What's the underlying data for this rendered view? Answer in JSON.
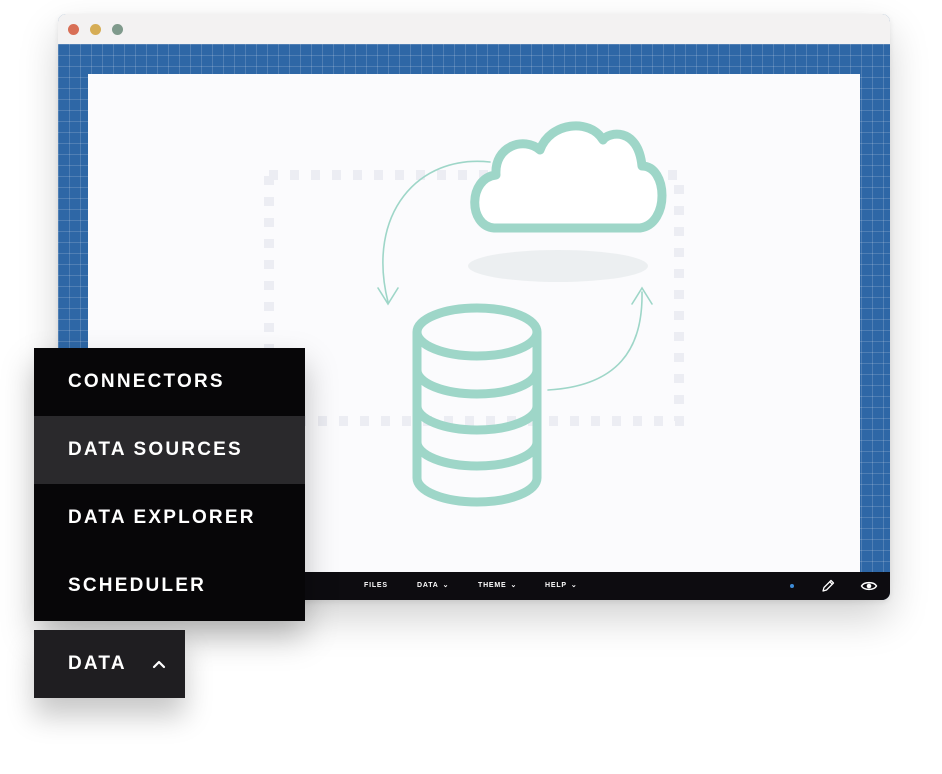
{
  "colors": {
    "accent_teal": "#9ed6c8",
    "grid_blue": "#2e67a6",
    "bar_black": "#0d0c10",
    "menu_active": "#2a292c"
  },
  "bottombar": {
    "menus": [
      {
        "label": "FILES",
        "has_caret": false
      },
      {
        "label": "DATA",
        "has_caret": true
      },
      {
        "label": "THEME",
        "has_caret": true
      },
      {
        "label": "HELP",
        "has_caret": true
      }
    ],
    "icons": [
      "status-dot-icon",
      "pencil-icon",
      "eye-icon"
    ]
  },
  "data_menu": {
    "items": [
      {
        "label": "CONNECTORS",
        "active": false
      },
      {
        "label": "DATA SOURCES",
        "active": true
      },
      {
        "label": "DATA EXPLORER",
        "active": false
      },
      {
        "label": "SCHEDULER",
        "active": false
      }
    ],
    "button_label": "DATA",
    "button_icon": "chevron-up-icon"
  },
  "illustration": {
    "icons": [
      "cloud-icon",
      "database-icon",
      "sync-arrow-icon"
    ]
  }
}
